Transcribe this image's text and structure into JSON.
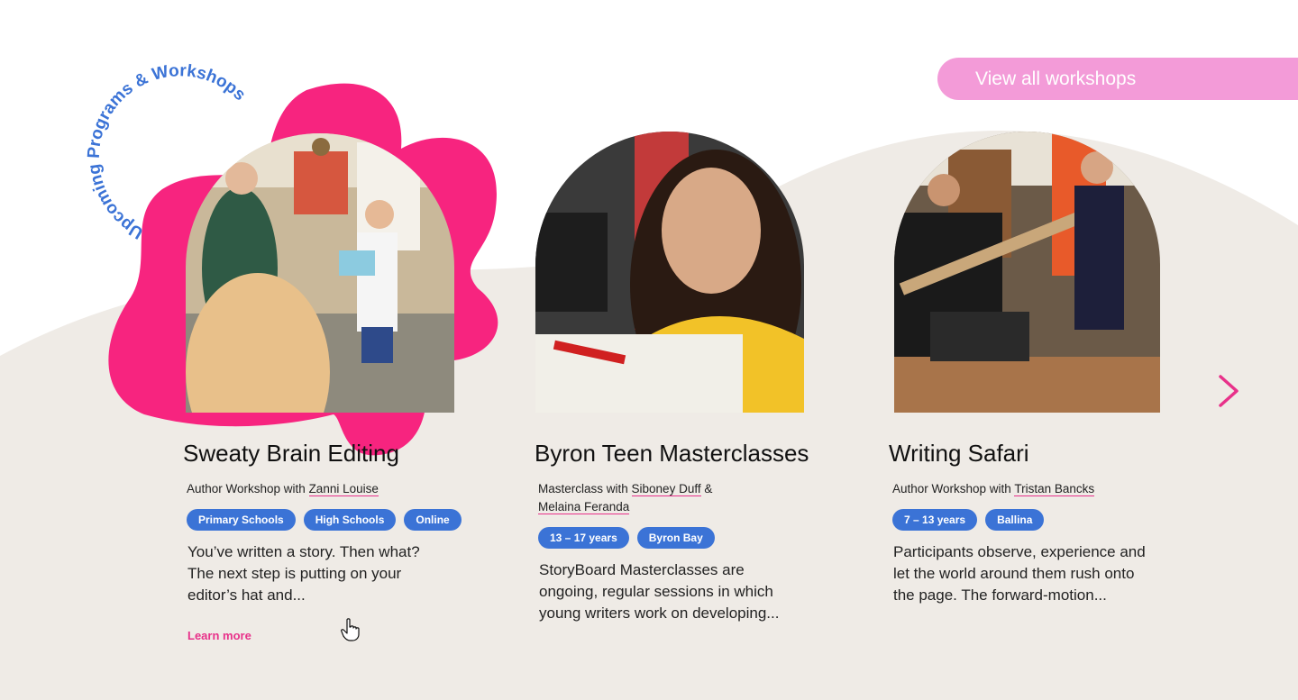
{
  "section": {
    "title": "Upcoming Programs & Workshops",
    "view_all_label": "View all workshops"
  },
  "colors": {
    "accent_pink": "#e8318a",
    "blob_pink": "#f7247f",
    "button_pink": "#f39bd8",
    "tag_blue": "#3b73d6",
    "sand": "#efebe6"
  },
  "cards": [
    {
      "title": "Sweaty Brain Editing",
      "byline_prefix": "Author Workshop with ",
      "authors": [
        "Zanni Louise"
      ],
      "tags": [
        "Primary Schools",
        "High Schools",
        "Online"
      ],
      "description": "You’ve written a story. Then what? The next step is putting on your editor’s hat and...",
      "learn_more": "Learn more"
    },
    {
      "title": "Byron Teen Masterclasses",
      "byline_prefix": "Masterclass with ",
      "authors": [
        "Siboney Duff",
        "Melaina Feranda"
      ],
      "author_joiner": " &",
      "tags": [
        "13 – 17 years",
        "Byron Bay"
      ],
      "description": "StoryBoard Masterclasses are ongoing, regular sessions in which young writers work on developing..."
    },
    {
      "title": "Writing Safari",
      "byline_prefix": "Author Workshop with ",
      "authors": [
        "Tristan Bancks"
      ],
      "tags": [
        "7 – 13 years",
        "Ballina"
      ],
      "description": "Participants observe, experience and let the world around them rush onto the page. The forward-motion..."
    }
  ],
  "icons": {
    "next": "chevron-right-icon",
    "cursor": "hand-pointer-icon"
  }
}
